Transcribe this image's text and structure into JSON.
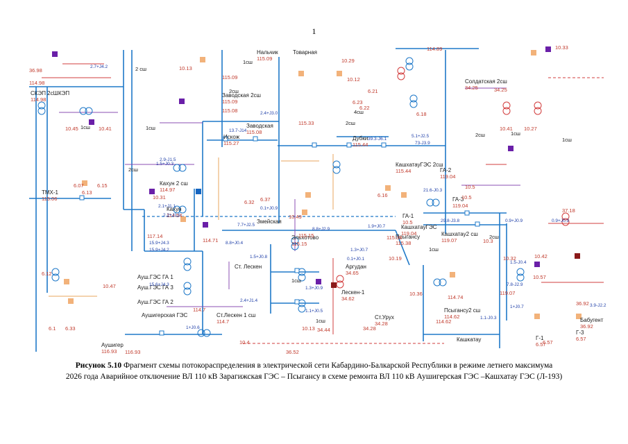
{
  "page_number": "1",
  "caption": {
    "bold": "Рисунок 5.10",
    "line1": " Фрагмент схемы потокораспределения в электрической сети Кабардино-Балкарской Республики в режиме летнего максимума",
    "line2": "2026 года Аварийное отключение ВЛ 110 кВ Зарагижская ГЭС – Псыгансу в схеме ремонта ВЛ 110 кВ Аушигерская ГЭС –Кашхатау ГЭС (Л-193)"
  },
  "colors": {
    "line_blue": "#1e78c8",
    "line_purple": "#8b4fb3",
    "line_red": "#d23c3c",
    "line_orange": "#e9a45c",
    "gen_square": "#f2b27a",
    "load_square": "#6a1fa8",
    "dark_red_square": "#8b1a1a",
    "blue_square": "#1565c0"
  },
  "substations": [
    {
      "name": "Нальчик",
      "voltage": "115.09"
    },
    {
      "name": "Товарная",
      "voltage": ""
    },
    {
      "name": "Заводская 2сш",
      "voltage": "115.09"
    },
    {
      "name": "Заводская",
      "voltage": "115.08"
    },
    {
      "name": "Искож",
      "voltage": "115.27"
    },
    {
      "name": "Дубки",
      "voltage": "115.44"
    },
    {
      "name": "КашхатауГЭС 2сш",
      "voltage": "115.44"
    },
    {
      "name": "Кахун 2 сш",
      "voltage": "114.97"
    },
    {
      "name": "Кахун",
      "voltage": "114.54"
    },
    {
      "name": "ТМХ-1",
      "voltage": "115.06"
    },
    {
      "name": "СКЭП 2сШКЭП",
      "voltage": "114.98"
    },
    {
      "name": "Солдатская 2сш",
      "voltage": "34.25"
    },
    {
      "name": "ГА-2",
      "voltage": "119.04"
    },
    {
      "name": "ГА-3",
      "voltage": "119.04"
    },
    {
      "name": "ГА-1",
      "voltage": "10.5"
    },
    {
      "name": "КашхатауГЭС",
      "voltage": "119.04"
    },
    {
      "name": "Кашхатау2 сш",
      "voltage": "119.07"
    },
    {
      "name": "Змейская",
      "voltage": ""
    },
    {
      "name": "Эльхотово",
      "voltage": "115.15"
    },
    {
      "name": "Псыгансу",
      "voltage": "115.38"
    },
    {
      "name": "Ст. Лескен",
      "voltage": ""
    },
    {
      "name": "Аргудан",
      "voltage": "34.65"
    },
    {
      "name": "Лескен-1",
      "voltage": "34.62"
    },
    {
      "name": "Ст.Урух",
      "voltage": "34.28"
    },
    {
      "name": "Ст.Лескен 1 сш",
      "voltage": "114.7"
    },
    {
      "name": "Аушигерская ГЭС",
      "voltage": ""
    },
    {
      "name": "Ауш.ГЭС ГА 1",
      "voltage": ""
    },
    {
      "name": "Ауш.ГЭС ГА 2",
      "voltage": ""
    },
    {
      "name": "Ауш.ГЭС ГА 3",
      "voltage": ""
    },
    {
      "name": "Аушигер",
      "voltage": "116.93"
    },
    {
      "name": "Псыгансу2 сш",
      "voltage": "114.62"
    },
    {
      "name": "Кашкатау",
      "voltage": ""
    },
    {
      "name": "Г-1",
      "voltage": "6.57"
    },
    {
      "name": "Г-3",
      "voltage": "6.57"
    },
    {
      "name": "Бабугент",
      "voltage": "36.92"
    }
  ],
  "bus_labels": [
    "2 сш",
    "1сш",
    "2сш",
    "1сш",
    "2сш",
    "1сш",
    "2сш",
    "1сш",
    "1сш",
    "2сш",
    "1сш",
    "1сш",
    "4сш",
    "2сш",
    "1сш"
  ],
  "flows": [
    "2.7+J4.2",
    "2.4+J3.0",
    "13.7-J14",
    "39.3-J6.1",
    "73-J3.9",
    "5.1+J2.5",
    "21.6-J0.3",
    "29.8-J3.8",
    "0.9+J0.9",
    "0.9+J0.9",
    "15.9+J4.3",
    "15.9+J4.2",
    "15.6+J4.3",
    "8.8+J0.4",
    "7.7+J2.5",
    "8.8+J2.9",
    "1.9+J0.7",
    "1.5+J0.8",
    "1.3+J0.7",
    "0.1+J0.1",
    "1.3+J0.9",
    "1.1+J0.5",
    "2.4+J1.4",
    "7.8-J2.9",
    "1.5-J0.4",
    "1.1-J0.3",
    "1+J0.7",
    "1+J0.6",
    "3.9-J2.2",
    "1.5+J0.3",
    "2.9-J1.5",
    "2.1+J1.1",
    "2.2+J1.5",
    "0.1+J0.9"
  ],
  "voltages": [
    "36.98",
    "114.98",
    "10.45",
    "10.41",
    "6.07",
    "6.15",
    "6.12",
    "6.1",
    "6.33",
    "6.13",
    "10.47",
    "115.09",
    "10.13",
    "115.08",
    "10.12",
    "6.23",
    "6.22",
    "115.33",
    "10.29",
    "6.21",
    "6.18",
    "114.89",
    "10.33",
    "34.25",
    "10.41",
    "10.27",
    "10.5",
    "10.31",
    "6.32",
    "6.37",
    "10.49",
    "6.16",
    "10.5",
    "37.18",
    "10.32",
    "10.42",
    "10.57",
    "36.92",
    "10.36",
    "10.19",
    "10.13",
    "10.3",
    "10.4",
    "36.52",
    "34.44",
    "34.28",
    "116.93",
    "117.14",
    "114.7",
    "114.71",
    "115.15",
    "115.38",
    "114.74",
    "119.07",
    "114.62",
    "6.57"
  ]
}
